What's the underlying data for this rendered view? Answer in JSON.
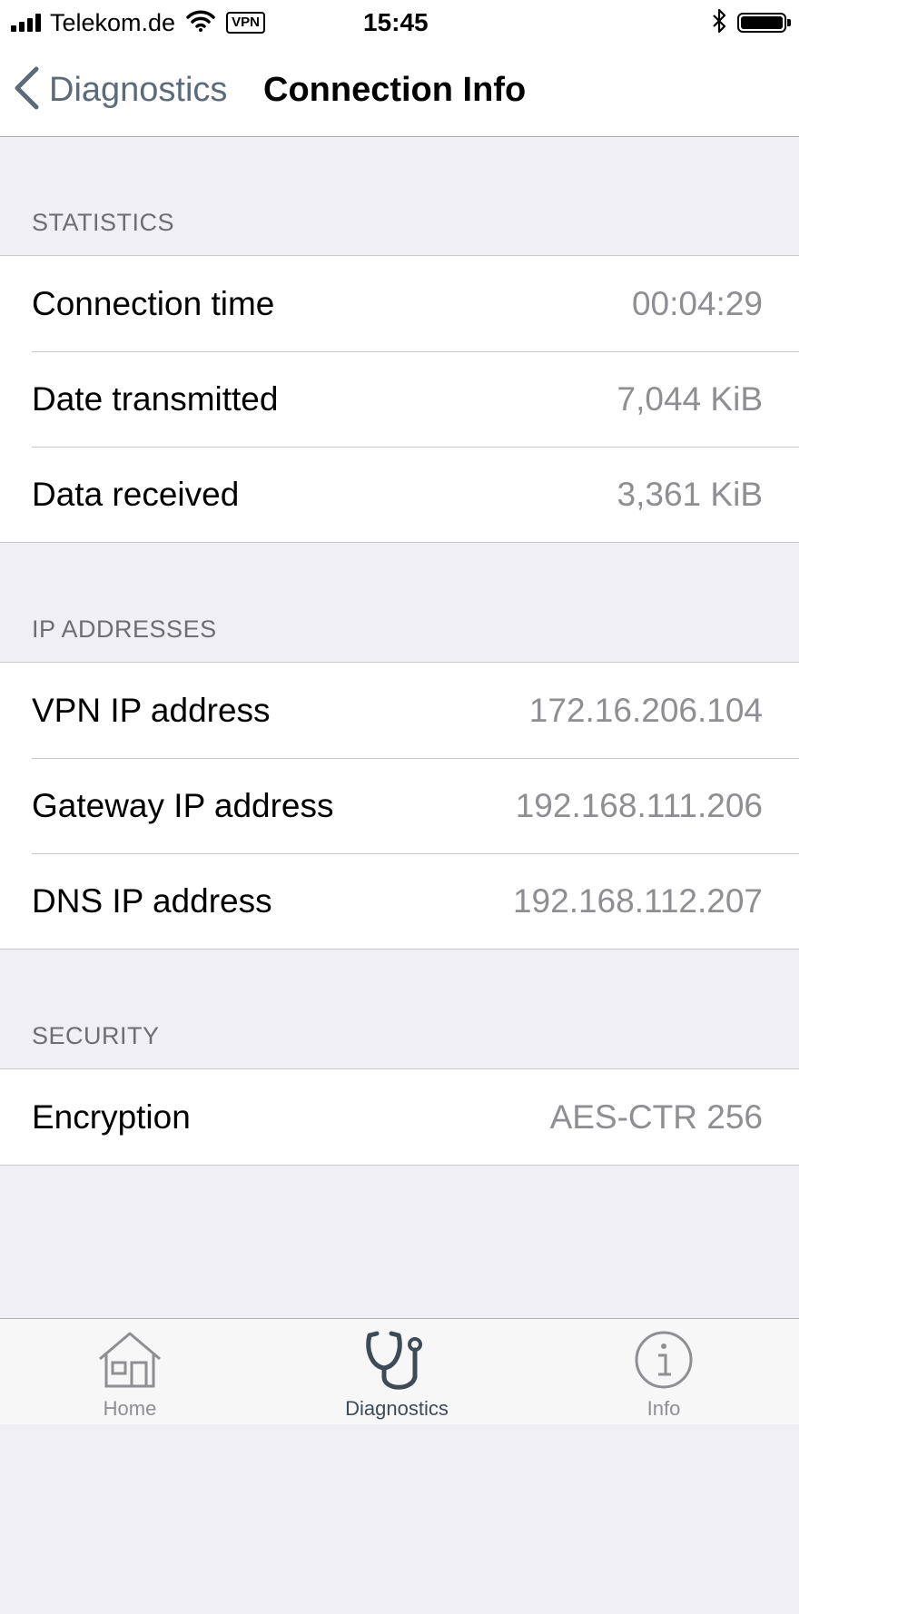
{
  "status_bar": {
    "carrier": "Telekom.de",
    "vpn_badge": "VPN",
    "time": "15:45"
  },
  "nav": {
    "back_label": "Diagnostics",
    "title": "Connection Info"
  },
  "sections": [
    {
      "header": "STATISTICS",
      "rows": [
        {
          "label": "Connection time",
          "value": "00:04:29"
        },
        {
          "label": "Date transmitted",
          "value": "7,044 KiB"
        },
        {
          "label": "Data received",
          "value": "3,361 KiB"
        }
      ]
    },
    {
      "header": "IP ADDRESSES",
      "rows": [
        {
          "label": "VPN IP address",
          "value": "172.16.206.104"
        },
        {
          "label": "Gateway IP address",
          "value": "192.168.111.206"
        },
        {
          "label": "DNS IP address",
          "value": "192.168.112.207"
        }
      ]
    },
    {
      "header": "SECURITY",
      "rows": [
        {
          "label": "Encryption",
          "value": "AES-CTR 256"
        }
      ]
    }
  ],
  "tab_bar": {
    "tabs": [
      {
        "label": "Home",
        "icon": "home-icon",
        "active": false
      },
      {
        "label": "Diagnostics",
        "icon": "stethoscope-icon",
        "active": true
      },
      {
        "label": "Info",
        "icon": "info-icon",
        "active": false
      }
    ]
  },
  "colors": {
    "background": "#efeff4",
    "value_text": "#8e8e93",
    "back_label": "#5b6b7a",
    "active_tab": "#3d4b59"
  }
}
